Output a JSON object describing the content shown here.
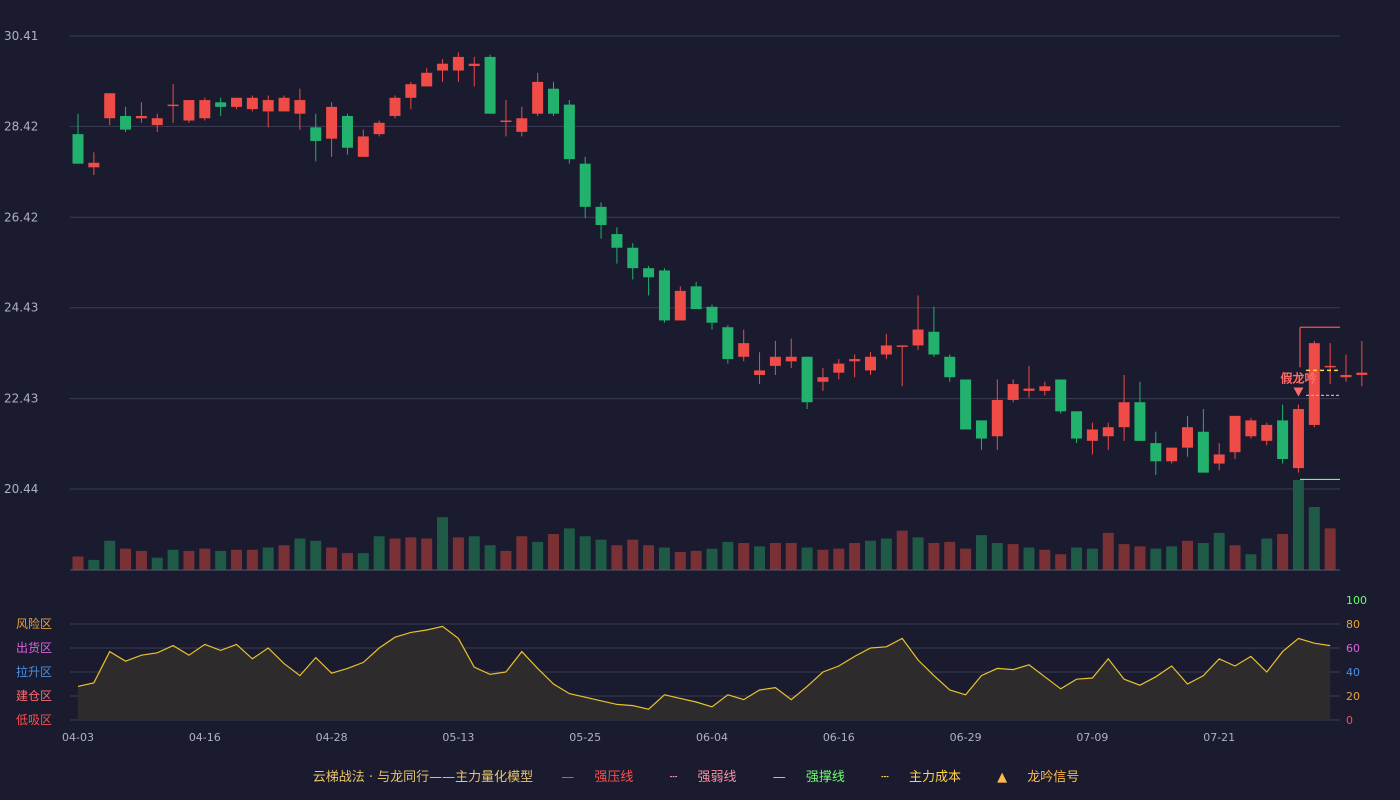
{
  "legend": {
    "title": "云梯战法 · 与龙同行——主力量化模型",
    "items": [
      {
        "label": "强压线",
        "color": "#ff4d4f",
        "style": "solid"
      },
      {
        "label": "强弱线",
        "color": "#ff8fa3",
        "style": "dashed"
      },
      {
        "label": "强撑线",
        "color": "#6bff6b",
        "style": "solid"
      },
      {
        "label": "主力成本",
        "color": "#ffd24d",
        "style": "dashed"
      },
      {
        "label": "龙吟信号",
        "color": "#ffb84d",
        "style": "triangle"
      }
    ]
  },
  "colors": {
    "up": "#ef4b47",
    "down": "#22b26e",
    "bg": "#1a1b2e",
    "grid": "#3a3c52",
    "osc": "#e8c22c"
  },
  "chart_data": [
    {
      "type": "candlestick",
      "title": "",
      "price_ticks": [
        "30.41",
        "28.42",
        "26.42",
        "24.43",
        "22.43",
        "20.44"
      ],
      "ylim": [
        20.44,
        30.41
      ],
      "x_ticks": [
        "04-03",
        "04-16",
        "04-28",
        "05-13",
        "05-25",
        "06-04",
        "06-16",
        "06-29",
        "07-09",
        "07-21"
      ],
      "candles": [
        [
          28.25,
          27.6,
          28.7,
          27.6
        ],
        [
          27.52,
          27.62,
          27.85,
          27.35
        ],
        [
          28.6,
          29.15,
          29.15,
          28.45
        ],
        [
          28.65,
          28.35,
          28.85,
          28.3
        ],
        [
          28.6,
          28.65,
          28.95,
          28.5
        ],
        [
          28.45,
          28.6,
          28.7,
          28.3
        ],
        [
          28.9,
          28.9,
          29.35,
          28.5
        ],
        [
          28.55,
          29.0,
          29.0,
          28.5
        ],
        [
          28.6,
          29.0,
          29.05,
          28.55
        ],
        [
          28.95,
          28.85,
          29.05,
          28.65
        ],
        [
          28.85,
          29.05,
          29.05,
          28.8
        ],
        [
          28.8,
          29.05,
          29.1,
          28.75
        ],
        [
          28.75,
          29.0,
          29.1,
          28.4
        ],
        [
          28.75,
          29.05,
          29.1,
          28.75
        ],
        [
          28.7,
          29.0,
          29.25,
          28.35
        ],
        [
          28.4,
          28.1,
          28.7,
          27.65
        ],
        [
          28.15,
          28.85,
          28.95,
          27.75
        ],
        [
          28.65,
          27.95,
          28.7,
          27.8
        ],
        [
          27.75,
          28.2,
          28.35,
          27.75
        ],
        [
          28.25,
          28.5,
          28.55,
          28.2
        ],
        [
          28.65,
          29.05,
          29.1,
          28.6
        ],
        [
          29.05,
          29.35,
          29.4,
          28.8
        ],
        [
          29.3,
          29.6,
          29.7,
          29.3
        ],
        [
          29.65,
          29.8,
          29.9,
          29.4
        ],
        [
          29.65,
          29.95,
          30.05,
          29.4
        ],
        [
          29.75,
          29.8,
          29.95,
          29.3
        ],
        [
          29.95,
          28.7,
          30.0,
          28.7
        ],
        [
          28.55,
          28.55,
          29.0,
          28.2
        ],
        [
          28.3,
          28.6,
          28.85,
          28.2
        ],
        [
          28.7,
          29.4,
          29.6,
          28.65
        ],
        [
          29.25,
          28.7,
          29.4,
          28.65
        ],
        [
          28.9,
          27.7,
          29.0,
          27.6
        ],
        [
          27.6,
          26.65,
          27.75,
          26.4
        ],
        [
          26.65,
          26.25,
          26.75,
          25.95
        ],
        [
          26.05,
          25.75,
          26.2,
          25.4
        ],
        [
          25.75,
          25.3,
          25.85,
          25.05
        ],
        [
          25.3,
          25.1,
          25.35,
          24.7
        ],
        [
          25.25,
          24.15,
          25.3,
          24.1
        ],
        [
          24.15,
          24.8,
          24.9,
          24.15
        ],
        [
          24.9,
          24.4,
          25.0,
          24.4
        ],
        [
          24.45,
          24.1,
          24.5,
          23.95
        ],
        [
          24.0,
          23.3,
          24.05,
          23.2
        ],
        [
          23.35,
          23.65,
          23.95,
          23.25
        ],
        [
          22.95,
          23.05,
          23.45,
          22.75
        ],
        [
          23.15,
          23.35,
          23.7,
          22.95
        ],
        [
          23.25,
          23.35,
          23.75,
          23.1
        ],
        [
          23.35,
          22.35,
          23.35,
          22.2
        ],
        [
          22.8,
          22.9,
          23.1,
          22.6
        ],
        [
          23.0,
          23.2,
          23.3,
          22.85
        ],
        [
          23.25,
          23.3,
          23.4,
          22.9
        ],
        [
          23.05,
          23.35,
          23.45,
          22.95
        ],
        [
          23.4,
          23.6,
          23.85,
          23.3
        ],
        [
          23.6,
          23.6,
          23.6,
          22.7
        ],
        [
          23.6,
          23.95,
          24.7,
          23.5
        ],
        [
          23.9,
          23.4,
          24.45,
          23.35
        ],
        [
          23.35,
          22.9,
          23.4,
          22.8
        ],
        [
          22.85,
          21.75,
          22.85,
          21.75
        ],
        [
          21.95,
          21.55,
          21.95,
          21.3
        ],
        [
          21.6,
          22.4,
          22.85,
          21.3
        ],
        [
          22.4,
          22.75,
          22.85,
          22.35
        ],
        [
          22.6,
          22.65,
          23.15,
          22.45
        ],
        [
          22.6,
          22.7,
          22.8,
          22.5
        ],
        [
          22.85,
          22.15,
          22.85,
          22.1
        ],
        [
          22.15,
          21.55,
          22.15,
          21.45
        ],
        [
          21.5,
          21.75,
          21.9,
          21.2
        ],
        [
          21.6,
          21.8,
          21.9,
          21.3
        ],
        [
          21.8,
          22.35,
          22.95,
          21.5
        ],
        [
          22.35,
          21.5,
          22.8,
          21.5
        ],
        [
          21.45,
          21.05,
          21.7,
          20.75
        ],
        [
          21.05,
          21.35,
          21.35,
          21.0
        ],
        [
          21.35,
          21.8,
          22.05,
          21.15
        ],
        [
          21.7,
          20.8,
          22.2,
          20.8
        ],
        [
          21.0,
          21.2,
          21.45,
          20.85
        ],
        [
          21.25,
          22.05,
          22.05,
          21.1
        ],
        [
          21.6,
          21.95,
          22.0,
          21.55
        ],
        [
          21.5,
          21.85,
          21.9,
          21.4
        ],
        [
          21.95,
          21.1,
          22.3,
          21.0
        ],
        [
          20.9,
          22.2,
          22.3,
          20.8
        ],
        [
          21.85,
          23.65,
          23.7,
          21.8
        ],
        [
          23.15,
          23.15,
          23.65,
          22.75
        ],
        [
          22.9,
          22.95,
          23.4,
          22.8
        ],
        [
          22.95,
          23.0,
          23.7,
          22.7
        ]
      ],
      "volume_up": [
        1,
        0,
        0,
        1,
        1,
        0,
        0,
        1,
        1,
        0,
        1,
        1,
        0,
        1,
        0,
        0,
        1,
        1,
        0,
        0,
        1,
        1,
        1,
        0,
        1,
        0,
        0,
        1,
        1,
        0,
        1,
        0,
        0,
        0,
        1,
        1,
        1,
        0,
        1,
        1,
        0,
        0,
        1,
        0,
        1,
        1,
        0,
        1,
        1,
        1,
        0,
        0,
        1,
        0,
        1,
        1,
        1,
        0,
        0,
        1,
        0,
        1,
        1,
        0,
        0,
        1,
        1,
        1,
        0,
        0,
        1,
        0,
        0,
        1,
        0,
        0,
        1,
        0,
        0,
        1,
        1,
        0
      ]
    },
    {
      "type": "volume",
      "values": [
        12,
        9,
        26,
        19,
        17,
        11,
        18,
        17,
        19,
        17,
        18,
        18,
        20,
        22,
        28,
        26,
        20,
        15,
        15,
        30,
        28,
        29,
        28,
        47,
        29,
        30,
        22,
        17,
        30,
        25,
        32,
        37,
        30,
        27,
        22,
        27,
        22,
        20,
        16,
        17,
        19,
        25,
        24,
        21,
        24,
        24,
        20,
        18,
        19,
        24,
        26,
        28,
        35,
        29,
        24,
        25,
        19,
        31,
        24,
        23,
        20,
        18,
        14,
        20,
        19,
        33,
        23,
        21,
        19,
        21,
        26,
        24,
        33,
        22,
        14,
        28,
        32,
        80,
        56,
        37
      ]
    },
    {
      "type": "line",
      "name": "",
      "y_ticks": [
        "100",
        "80",
        "60",
        "40",
        "20",
        "0"
      ],
      "zone_labels": [
        "风险区",
        "出货区",
        "拉升区",
        "建仓区",
        "低吸区"
      ],
      "values": [
        28,
        31,
        57,
        49,
        54,
        56,
        62,
        54,
        63,
        58,
        63,
        51,
        60,
        47,
        37,
        52,
        39,
        43,
        48,
        60,
        69,
        73,
        75,
        78,
        68,
        44,
        38,
        40,
        57,
        43,
        30,
        22,
        19,
        16,
        13,
        12,
        9,
        21,
        18,
        15,
        11,
        21,
        17,
        25,
        27,
        17,
        28,
        40,
        45,
        53,
        60,
        61,
        68,
        50,
        37,
        25,
        21,
        37,
        43,
        42,
        46,
        36,
        26,
        34,
        35,
        51,
        34,
        29,
        36,
        45,
        30,
        37,
        51,
        45,
        53,
        40,
        57,
        68,
        64,
        62
      ]
    },
    {
      "type": "annotation",
      "signal_label": "假龙吟",
      "resistance": 24.0,
      "weak_line": 22.5,
      "support": 20.65,
      "cost": 23.05
    }
  ]
}
